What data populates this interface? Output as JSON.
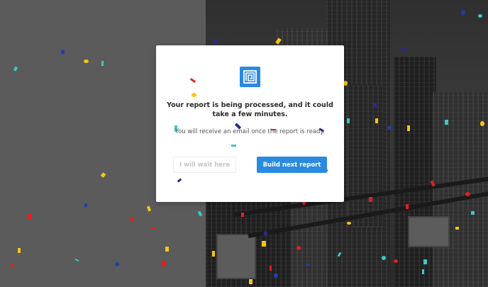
{
  "modal": {
    "title": "Your report is being processed, and it could take a few minutes.",
    "subtitle": "You will receive an email once the report is ready.",
    "wait_label": "I will wait here",
    "build_label": "Build next report",
    "logo_icon": "square-spiral-icon"
  },
  "colors": {
    "accent": "#2a8ae0",
    "confetti": [
      "#e02020",
      "#f5c518",
      "#2a2a8a",
      "#3cc8c8",
      "#1e3fa8"
    ]
  }
}
